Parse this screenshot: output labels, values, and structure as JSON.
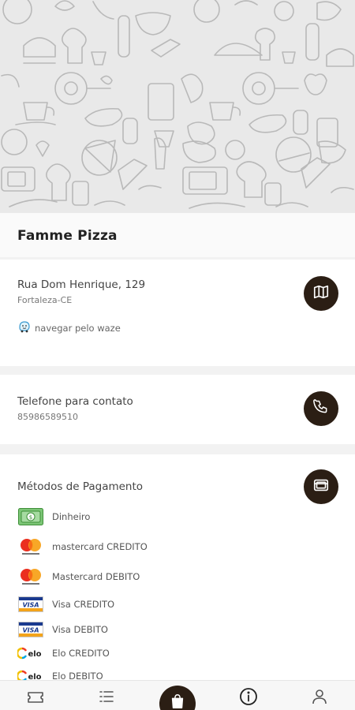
{
  "restaurant": {
    "name": "Famme Pizza"
  },
  "address": {
    "street": "Rua Dom Henrique, 129",
    "city": "Fortaleza-CE",
    "waze_label": "navegar pelo waze",
    "icon": "map-icon"
  },
  "contact": {
    "label": "Telefone para contato",
    "phone": "85986589510",
    "icon": "phone-icon"
  },
  "payments": {
    "title": "Métodos de Pagamento",
    "icon": "card-icon",
    "items": [
      {
        "label": "Dinheiro",
        "logo": "cash-icon"
      },
      {
        "label": "mastercard CREDITO",
        "logo": "mastercard-logo"
      },
      {
        "label": "Mastercard DEBITO",
        "logo": "mastercard-logo"
      },
      {
        "label": "Visa CREDITO",
        "logo": "visa-logo"
      },
      {
        "label": "Visa DEBITO",
        "logo": "visa-logo"
      },
      {
        "label": "Elo CREDITO",
        "logo": "elo-logo"
      },
      {
        "label": "Elo DEBITO",
        "logo": "elo-logo"
      }
    ]
  },
  "bottom_nav": {
    "items": [
      "ticket-icon",
      "list-icon",
      "bag-icon",
      "info-icon",
      "user-icon"
    ]
  },
  "colors": {
    "accent": "#2b1e14",
    "background": "#f2f2f2"
  }
}
